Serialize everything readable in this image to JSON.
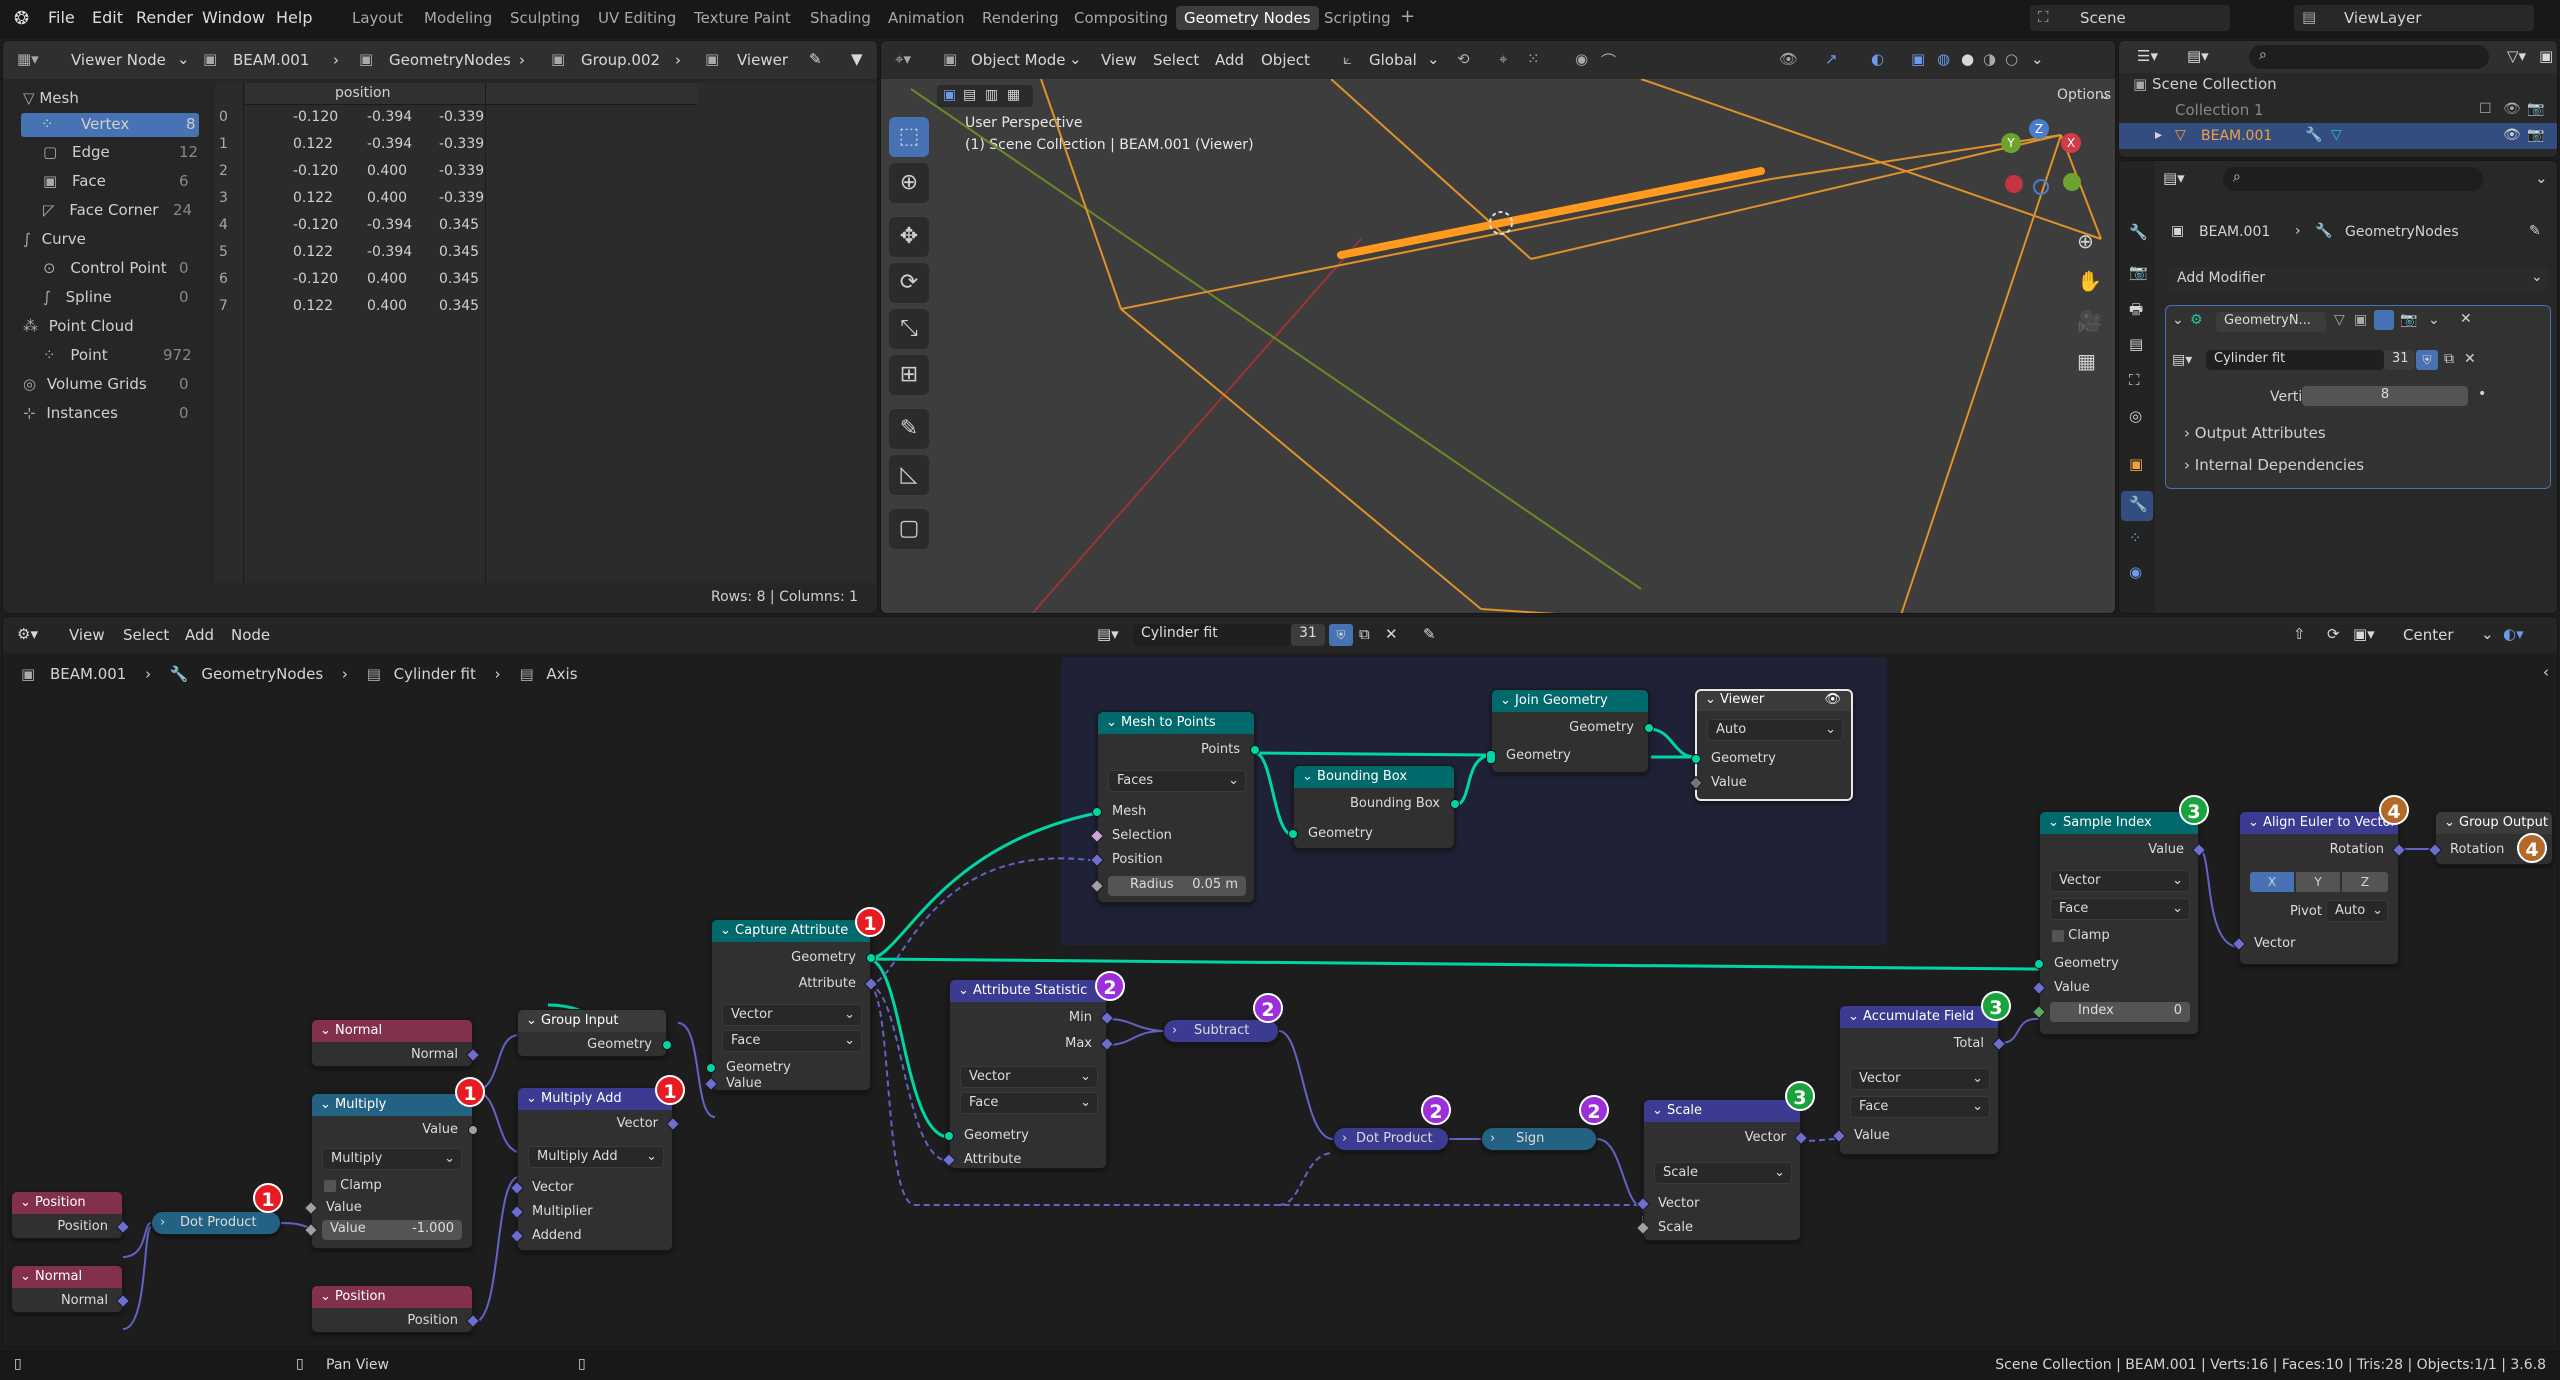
{
  "topbar": {
    "menus": [
      "File",
      "Edit",
      "Render",
      "Window",
      "Help"
    ],
    "workspaces": [
      "Layout",
      "Modeling",
      "Sculpting",
      "UV Editing",
      "Texture Paint",
      "Shading",
      "Animation",
      "Rendering",
      "Compositing",
      "Geometry Nodes",
      "Scripting"
    ],
    "active_workspace": "Geometry Nodes",
    "add_tab": "+",
    "scene": "Scene",
    "view_layer": "ViewLayer"
  },
  "spreadsheet": {
    "viewer_mode": "Viewer Node",
    "breadcrumbs": [
      "BEAM.001",
      "GeometryNodes",
      "Group.002",
      "Viewer"
    ],
    "column_header": "position",
    "tree": [
      {
        "label": "Mesh",
        "count": ""
      },
      {
        "label": "Vertex",
        "count": "8"
      },
      {
        "label": "Edge",
        "count": "12"
      },
      {
        "label": "Face",
        "count": "6"
      },
      {
        "label": "Face Corner",
        "count": "24"
      },
      {
        "label": "Curve",
        "count": ""
      },
      {
        "label": "Control Point",
        "count": "0"
      },
      {
        "label": "Spline",
        "count": "0"
      },
      {
        "label": "Point Cloud",
        "count": ""
      },
      {
        "label": "Point",
        "count": "972"
      },
      {
        "label": "Volume Grids",
        "count": "0"
      },
      {
        "label": "Instances",
        "count": "0"
      }
    ],
    "rows": [
      [
        "0",
        "-0.120",
        "-0.394",
        "-0.339"
      ],
      [
        "1",
        "0.122",
        "-0.394",
        "-0.339"
      ],
      [
        "2",
        "-0.120",
        "0.400",
        "-0.339"
      ],
      [
        "3",
        "0.122",
        "0.400",
        "-0.339"
      ],
      [
        "4",
        "-0.120",
        "-0.394",
        "0.345"
      ],
      [
        "5",
        "0.122",
        "-0.394",
        "0.345"
      ],
      [
        "6",
        "-0.120",
        "0.400",
        "0.345"
      ],
      [
        "7",
        "0.122",
        "0.400",
        "0.345"
      ]
    ],
    "footer": "Rows: 8   |   Columns: 1"
  },
  "viewport": {
    "menus": [
      "Object Mode",
      "View",
      "Select",
      "Add",
      "Object"
    ],
    "transform": "Global",
    "options": "Options",
    "overlay_title": "User Perspective",
    "overlay_sub": "(1) Scene Collection | BEAM.001 (Viewer)"
  },
  "outliner": {
    "root": "Scene Collection",
    "items": [
      "Collection 1",
      "BEAM.001"
    ]
  },
  "properties": {
    "breadcrumb": [
      "BEAM.001",
      "GeometryNodes"
    ],
    "add_modifier": "Add Modifier",
    "modifier_name": "GeometryN...",
    "group_name": "Cylinder fit",
    "group_users": "31",
    "vertices_label": "Vertices",
    "vertices_value": "8",
    "output_attributes": "Output Attributes",
    "internal_dependencies": "Internal Dependencies"
  },
  "node_editor": {
    "menus": [
      "View",
      "Select",
      "Add",
      "Node"
    ],
    "group_name": "Cylinder fit",
    "group_users": "31",
    "pivot": "Center",
    "breadcrumbs": [
      "BEAM.001",
      "GeometryNodes",
      "Cylinder fit",
      "Axis"
    ]
  },
  "nodes": {
    "position1": {
      "title": "Position",
      "out": "Position"
    },
    "normal1": {
      "title": "Normal",
      "out": "Normal"
    },
    "dot1": {
      "title": "Dot Product"
    },
    "normal2": {
      "title": "Normal",
      "out": "Normal"
    },
    "multiply": {
      "title": "Multiply",
      "out": "Value",
      "mode": "Multiply",
      "clamp": "Clamp",
      "in": "Value",
      "value_label": "Value",
      "value": "-1.000"
    },
    "position2": {
      "title": "Position",
      "out": "Position"
    },
    "group_input": {
      "title": "Group Input",
      "out": "Geometry"
    },
    "multiply_add": {
      "title": "Multiply Add",
      "out": "Vector",
      "mode": "Multiply Add",
      "in1": "Vector",
      "in2": "Multiplier",
      "in3": "Addend"
    },
    "capture": {
      "title": "Capture Attribute",
      "out1": "Geometry",
      "out2": "Attribute",
      "type": "Vector",
      "domain": "Face",
      "in1": "Geometry",
      "in2": "Value"
    },
    "mesh_to_points": {
      "title": "Mesh to Points",
      "out": "Points",
      "mode": "Faces",
      "in1": "Mesh",
      "in2": "Selection",
      "in3": "Position",
      "radius_label": "Radius",
      "radius": "0.05 m"
    },
    "bounding_box": {
      "title": "Bounding Box",
      "out": "Bounding Box",
      "in": "Geometry"
    },
    "join": {
      "title": "Join Geometry",
      "out": "Geometry",
      "in": "Geometry"
    },
    "viewer": {
      "title": "Viewer",
      "mode": "Auto",
      "in1": "Geometry",
      "in2": "Value"
    },
    "attr_stat": {
      "title": "Attribute Statistic",
      "out1": "Min",
      "out2": "Max",
      "type": "Vector",
      "domain": "Face",
      "in1": "Geometry",
      "in2": "Attribute"
    },
    "subtract": {
      "title": "Subtract"
    },
    "dot2": {
      "title": "Dot Product"
    },
    "sign": {
      "title": "Sign"
    },
    "scale": {
      "title": "Scale",
      "out": "Vector",
      "mode": "Scale",
      "in1": "Vector",
      "in2": "Scale"
    },
    "accumulate": {
      "title": "Accumulate Field",
      "out": "Total",
      "type": "Vector",
      "domain": "Face",
      "in": "Value"
    },
    "sample_index": {
      "title": "Sample Index",
      "out": "Value",
      "type": "Vector",
      "domain": "Face",
      "clamp": "Clamp",
      "in1": "Geometry",
      "in2": "Value",
      "index_label": "Index",
      "index": "0"
    },
    "align_euler": {
      "title": "Align Euler to Vector",
      "out": "Rotation",
      "axes": [
        "X",
        "Y",
        "Z"
      ],
      "pivot_label": "Pivot",
      "pivot": "Auto",
      "in": "Vector"
    },
    "group_output": {
      "title": "Group Output",
      "in": "Rotation"
    }
  },
  "badges": {
    "one": "1",
    "two": "2",
    "three": "3",
    "four": "4"
  },
  "statusbar": {
    "pan": "Pan View",
    "info": "Scene Collection | BEAM.001 | Verts:16 | Faces:10 | Tris:28 | Objects:1/1 | 3.6.8"
  },
  "colors": {
    "geometry": "#00d6a3",
    "vector": "#6363c7",
    "float": "#a1a1a1",
    "input_header": "#83314a",
    "math_header": "#246283",
    "geo_header": "#00696b",
    "frame": "#1f2236"
  }
}
